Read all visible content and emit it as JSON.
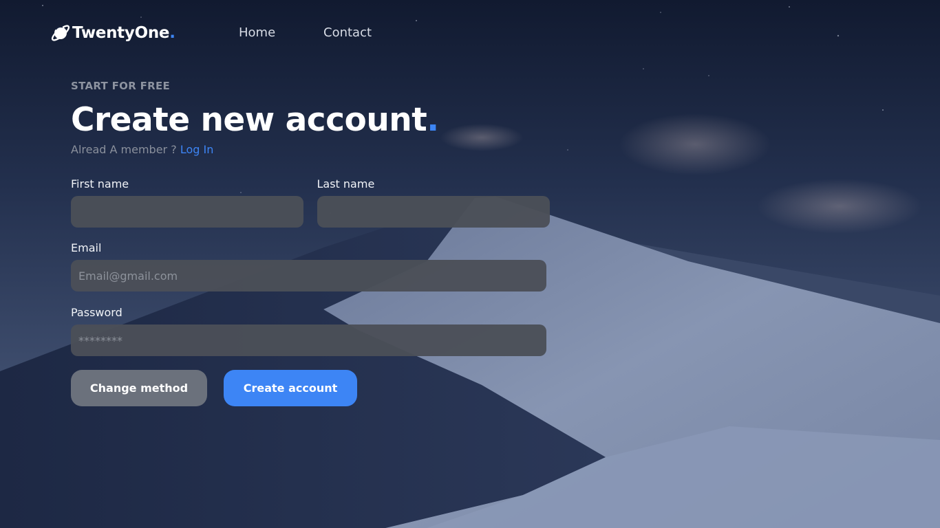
{
  "brand": {
    "name": "TwentyOne",
    "dot": ".",
    "accent_color": "#3d85f5"
  },
  "nav": {
    "items": [
      {
        "label": "Home"
      },
      {
        "label": "Contact"
      }
    ]
  },
  "hero": {
    "eyebrow": "START FOR FREE",
    "title": "Create new account",
    "title_dot": ".",
    "member_text": "Alread A member ?",
    "login_link": "Log In"
  },
  "form": {
    "first_name": {
      "label": "First name",
      "value": "",
      "placeholder": ""
    },
    "last_name": {
      "label": "Last name",
      "value": "",
      "placeholder": ""
    },
    "email": {
      "label": "Email",
      "value": "",
      "placeholder": "Email@gmail.com"
    },
    "password": {
      "label": "Password",
      "value": "",
      "placeholder": "********"
    }
  },
  "buttons": {
    "change_method": "Change method",
    "create_account": "Create account"
  },
  "icons": {
    "logo": "planet-icon"
  },
  "colors": {
    "accent": "#3d85f5",
    "secondary_button": "#6b717c",
    "input_bg": "#4b4f57"
  }
}
